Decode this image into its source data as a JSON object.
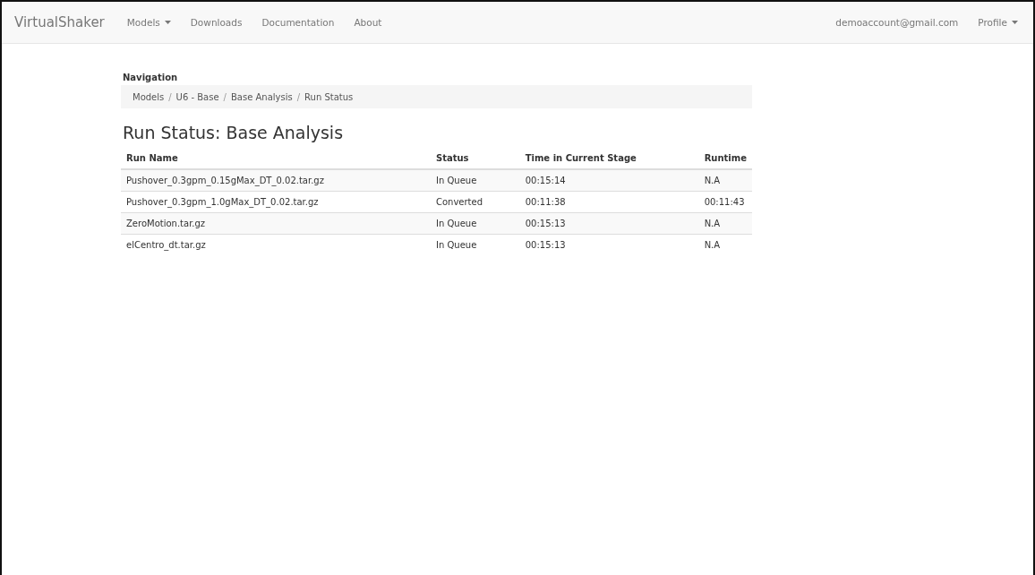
{
  "navbar": {
    "brand": "VirtualShaker",
    "links": [
      {
        "label": "Models",
        "dropdown": true
      },
      {
        "label": "Downloads",
        "dropdown": false
      },
      {
        "label": "Documentation",
        "dropdown": false
      },
      {
        "label": "About",
        "dropdown": false
      }
    ],
    "right": [
      {
        "label": "demoaccount@gmail.com",
        "dropdown": false
      },
      {
        "label": "Profile",
        "dropdown": true
      }
    ]
  },
  "navigation": {
    "heading": "Navigation",
    "breadcrumbs": [
      "Models",
      "U6 - Base",
      "Base Analysis",
      "Run Status"
    ],
    "separators": [
      "/",
      "/",
      "/"
    ]
  },
  "title": "Run Status: Base Analysis",
  "table": {
    "columns": [
      "Run Name",
      "Status",
      "Time in Current Stage",
      "Runtime"
    ],
    "rows": [
      [
        "Pushover_0.3gpm_0.15gMax_DT_0.02.tar.gz",
        "In Queue",
        "00:15:14",
        "N.A"
      ],
      [
        "Pushover_0.3gpm_1.0gMax_DT_0.02.tar.gz",
        "Converted",
        "00:11:38",
        "00:11:43"
      ],
      [
        "ZeroMotion.tar.gz",
        "In Queue",
        "00:15:13",
        "N.A"
      ],
      [
        "elCentro_dt.tar.gz",
        "In Queue",
        "00:15:13",
        "N.A"
      ]
    ]
  }
}
